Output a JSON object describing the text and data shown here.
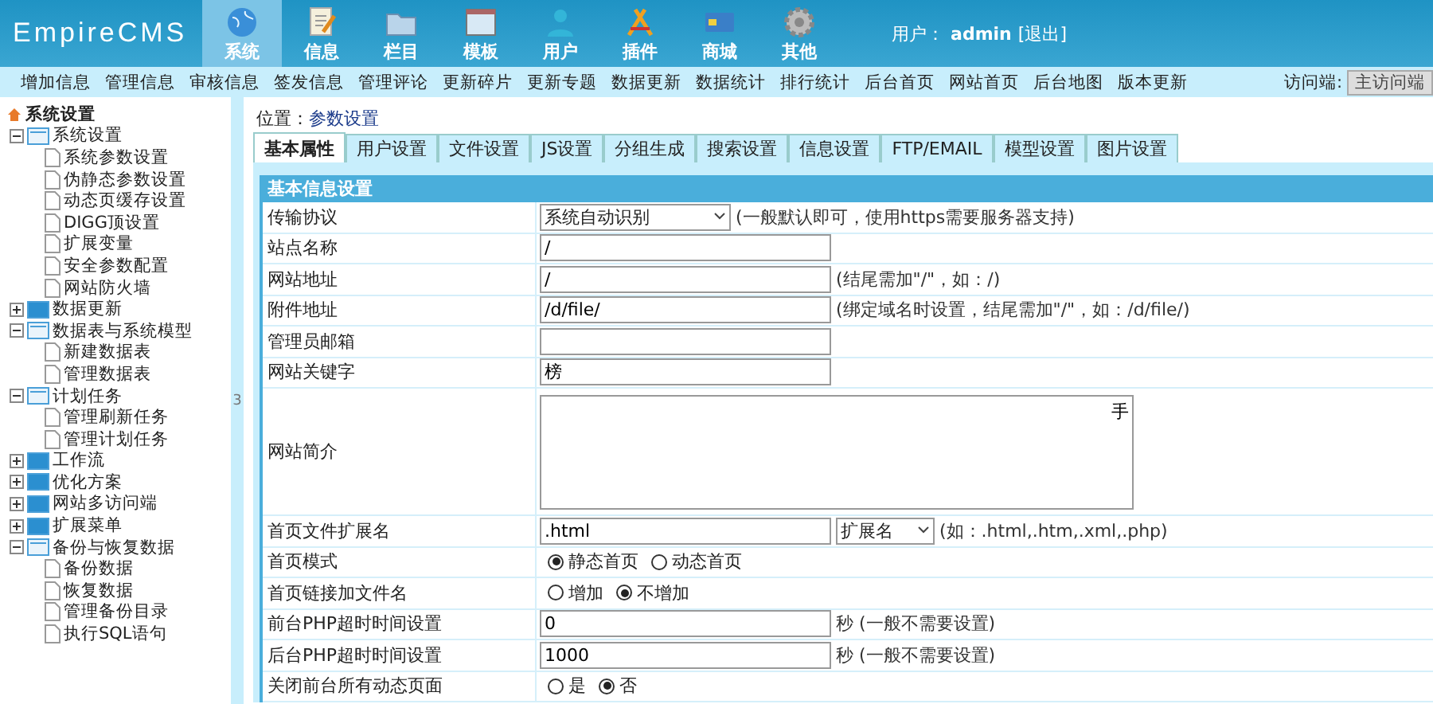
{
  "header": {
    "logo": "EmpireCMS",
    "nav": [
      {
        "label": "系统",
        "kind": "globe",
        "selected": true
      },
      {
        "label": "信息",
        "kind": "note",
        "selected": false
      },
      {
        "label": "栏目",
        "kind": "folder",
        "selected": false
      },
      {
        "label": "模板",
        "kind": "window",
        "selected": false
      },
      {
        "label": "用户",
        "kind": "person",
        "selected": false
      },
      {
        "label": "插件",
        "kind": "tools",
        "selected": false
      },
      {
        "label": "商城",
        "kind": "card",
        "selected": false
      },
      {
        "label": "其他",
        "kind": "gear",
        "selected": false
      }
    ],
    "user_label": "用户：",
    "user": "admin",
    "logout": "[退出]"
  },
  "menu_bar": {
    "links": [
      "增加信息",
      "管理信息",
      "审核信息",
      "签发信息",
      "管理评论",
      "更新碎片",
      "更新专题",
      "数据更新",
      "数据统计",
      "排行统计",
      "后台首页",
      "网站首页",
      "后台地图",
      "版本更新"
    ],
    "access_label": "访问端:",
    "access_value": "主访问端"
  },
  "sidebar": {
    "root": "系统设置",
    "groups": [
      {
        "label": "系统设置",
        "expanded": true,
        "children": [
          "系统参数设置",
          "伪静态参数设置",
          "动态页缓存设置",
          "DIGG顶设置",
          "扩展变量",
          "安全参数配置",
          "网站防火墙"
        ]
      },
      {
        "label": "数据更新",
        "expanded": false
      },
      {
        "label": "数据表与系统模型",
        "expanded": true,
        "children": [
          "新建数据表",
          "管理数据表"
        ]
      },
      {
        "label": "计划任务",
        "expanded": true,
        "children": [
          "管理刷新任务",
          "管理计划任务"
        ]
      },
      {
        "label": "工作流",
        "expanded": false
      },
      {
        "label": "优化方案",
        "expanded": false
      },
      {
        "label": "网站多访问端",
        "expanded": false
      },
      {
        "label": "扩展菜单",
        "expanded": false
      },
      {
        "label": "备份与恢复数据",
        "expanded": true,
        "children": [
          "备份数据",
          "恢复数据",
          "管理备份目录",
          "执行SQL语句"
        ]
      }
    ]
  },
  "splitter_mark": "3",
  "breadcrumb": {
    "label": "位置：",
    "current": "参数设置"
  },
  "tabs": [
    {
      "label": "基本属性",
      "selected": true
    },
    {
      "label": "用户设置",
      "selected": false
    },
    {
      "label": "文件设置",
      "selected": false
    },
    {
      "label": "JS设置",
      "selected": false
    },
    {
      "label": "分组生成",
      "selected": false
    },
    {
      "label": "搜索设置",
      "selected": false
    },
    {
      "label": "信息设置",
      "selected": false
    },
    {
      "label": "FTP/EMAIL",
      "selected": false
    },
    {
      "label": "模型设置",
      "selected": false
    },
    {
      "label": "图片设置",
      "selected": false
    }
  ],
  "form": {
    "title": "基本信息设置",
    "rows": [
      {
        "label": "传输协议",
        "kind": "select",
        "value": "系统自动识别",
        "hint": "(一般默认即可，使用https需要服务器支持)"
      },
      {
        "label": "站点名称",
        "kind": "text",
        "value": "/"
      },
      {
        "label": "网站地址",
        "kind": "text",
        "value": "/",
        "hint": "(结尾需加\"/\"，如：/)"
      },
      {
        "label": "附件地址",
        "kind": "text",
        "value": "/d/file/",
        "hint": "(绑定域名时设置，结尾需加\"/\"，如：/d/file/)"
      },
      {
        "label": "管理员邮箱",
        "kind": "text"
      },
      {
        "label": "网站关键字",
        "kind": "text",
        "value": "榜"
      },
      {
        "label": "网站简介",
        "kind": "textarea",
        "value": "手"
      },
      {
        "label": "首页文件扩展名",
        "kind": "text_select",
        "value": ".html",
        "select": "扩展名",
        "hint": "(如：.html,.htm,.xml,.php)"
      },
      {
        "label": "首页模式",
        "kind": "radio",
        "options": [
          {
            "label": "静态首页",
            "selected": true
          },
          {
            "label": "动态首页",
            "selected": false
          }
        ]
      },
      {
        "label": "首页链接加文件名",
        "kind": "radio",
        "options": [
          {
            "label": "增加",
            "selected": false
          },
          {
            "label": "不增加",
            "selected": true
          }
        ]
      },
      {
        "label": "前台PHP超时时间设置",
        "kind": "text",
        "value": "0",
        "hint": "秒 (一般不需要设置)"
      },
      {
        "label": "后台PHP超时时间设置",
        "kind": "text",
        "value": "1000",
        "hint": "秒 (一般不需要设置)"
      },
      {
        "label": "关闭前台所有动态页面",
        "kind": "radio",
        "options": [
          {
            "label": "是",
            "selected": false
          },
          {
            "label": "否",
            "selected": true
          }
        ]
      }
    ]
  }
}
